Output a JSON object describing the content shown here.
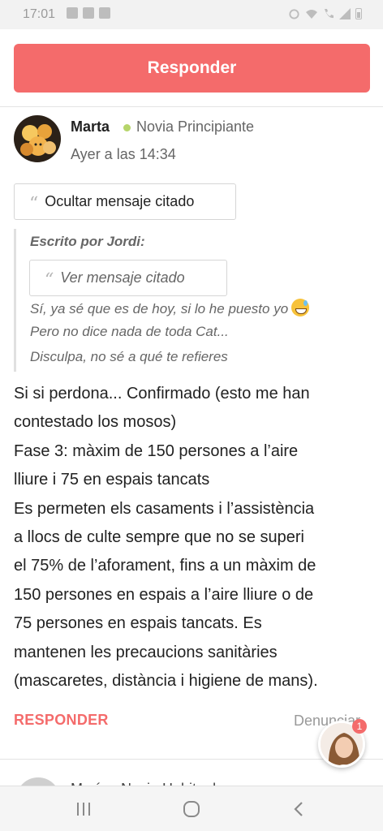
{
  "status_bar": {
    "time": "17:01"
  },
  "top_bar": {
    "reply_label": "Responder"
  },
  "post": {
    "author": "Marta",
    "rank": "Novia Principiante",
    "date": "Ayer a las 14:34",
    "quote_toggle_label": "Ocultar mensaje citado",
    "quote": {
      "written_by": "Escrito por Jordi:",
      "nested_label": "Ver mensaje citado",
      "lines": [
        "Sí, ya sé que es de hoy, si lo he puesto yo",
        "Pero no dice nada de toda Cat...",
        "Disculpa, no sé a qué te refieres"
      ]
    },
    "body_lines": [
      "Si si perdona... Confirmado (esto me han",
      "contestado los mosos)",
      "Fase 3: màxim de 150 persones a l’aire",
      "lliure i 75 en espais tancats",
      "Es permeten els casaments i l’assistència",
      "a llocs de culte sempre que no se superi",
      "el 75% de l’aforament, fins a un màxim de",
      "150 persones en espais a l’aire lliure o de",
      "75 persones en espais tancats. Es",
      "mantenen les precaucions sanitàries",
      "(mascaretes, distància i higiene de mans)."
    ],
    "reply_link": "RESPONDER",
    "report_link": "Denunciar"
  },
  "next_post": {
    "author_partial": "María · Novia Habitual"
  },
  "chat_badge": "1",
  "colors": {
    "accent": "#f46b6b",
    "online": "#b6d56a"
  }
}
